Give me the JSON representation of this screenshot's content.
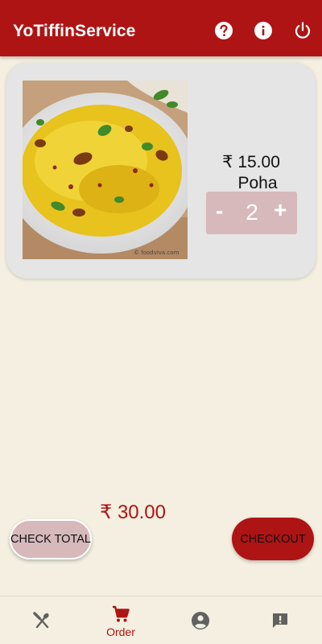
{
  "appbar": {
    "title": "YoTiffinService",
    "actions": [
      {
        "icon": "help-icon"
      },
      {
        "icon": "info-icon"
      },
      {
        "icon": "power-icon"
      }
    ]
  },
  "cart": {
    "items": [
      {
        "name": "Poha",
        "price": "₹ 15.00",
        "quantity": "2",
        "minus_label": "-",
        "plus_label": "+",
        "image": "poha-dish-image",
        "watermark": "© foodviva.com"
      }
    ]
  },
  "footer": {
    "total": "₹ 30.00",
    "check_total_label": "CHECK TOTAL",
    "checkout_label": "CHECKOUT"
  },
  "bottom_nav": {
    "items": [
      {
        "icon": "restaurant-icon",
        "label": ""
      },
      {
        "icon": "cart-icon",
        "label": "Order"
      },
      {
        "icon": "account-icon",
        "label": ""
      },
      {
        "icon": "feedback-icon",
        "label": ""
      }
    ],
    "active_index": 1
  },
  "colors": {
    "primary": "#ae1414",
    "background": "#f4efe0",
    "card": "#e5e5e5",
    "quantity_box": "#d7b9bb",
    "nav_icon": "#616161"
  }
}
